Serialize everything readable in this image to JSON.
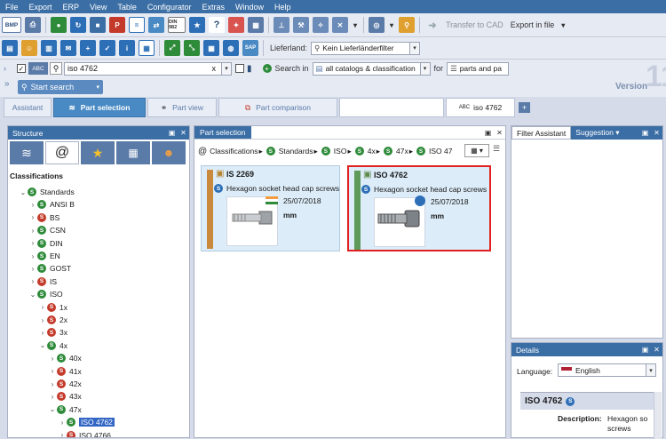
{
  "menu": [
    "File",
    "Export",
    "ERP",
    "View",
    "Table",
    "Configurator",
    "Extras",
    "Window",
    "Help"
  ],
  "toolbar1": {
    "bmp_label": "BMP",
    "din_label": "DIN 982",
    "transfer_cad": "Transfer to CAD",
    "export_file": "Export in file"
  },
  "toolbar2": {
    "lieferland_label": "Lieferland:",
    "lieferland_value": "Kein Lieferländerfilter"
  },
  "search": {
    "abc": "ABC",
    "query": "iso 4762",
    "clear": "x",
    "search_in_label": "Search in",
    "search_in_value": "all catalogs & classification",
    "for_label": "for",
    "for_value": "parts and pa",
    "start_button": "Start search",
    "version_label": "Version",
    "version_number": "11"
  },
  "tabs": {
    "assistant": "Assistant",
    "part_selection": "Part selection",
    "part_view": "Part view",
    "part_comparison": "Part comparison",
    "query_tab": "iso 4762",
    "abc": "ABC",
    "add": "+"
  },
  "structure": {
    "title": "Structure",
    "at_sign": "@",
    "classifications_label": "Classifications",
    "tree": [
      {
        "label": "Standards",
        "color": "green",
        "level": 0,
        "expanded": true
      },
      {
        "label": "ANSI B",
        "color": "green",
        "level": 1
      },
      {
        "label": "BS",
        "color": "red",
        "level": 1
      },
      {
        "label": "CSN",
        "color": "green",
        "level": 1
      },
      {
        "label": "DIN",
        "color": "green",
        "level": 1
      },
      {
        "label": "EN",
        "color": "green",
        "level": 1
      },
      {
        "label": "GOST",
        "color": "green",
        "level": 1
      },
      {
        "label": "IS",
        "color": "red",
        "level": 1
      },
      {
        "label": "ISO",
        "color": "green",
        "level": 1,
        "expanded": true
      },
      {
        "label": "1x",
        "color": "red",
        "level": 2
      },
      {
        "label": "2x",
        "color": "red",
        "level": 2
      },
      {
        "label": "3x",
        "color": "red",
        "level": 2
      },
      {
        "label": "4x",
        "color": "green",
        "level": 2,
        "expanded": true
      },
      {
        "label": "40x",
        "color": "green",
        "level": 3
      },
      {
        "label": "41x",
        "color": "red",
        "level": 3
      },
      {
        "label": "42x",
        "color": "red",
        "level": 3
      },
      {
        "label": "43x",
        "color": "red",
        "level": 3
      },
      {
        "label": "47x",
        "color": "green",
        "level": 3,
        "expanded": true
      },
      {
        "label": "ISO 4762",
        "color": "green",
        "level": 4,
        "selected": true
      },
      {
        "label": "ISO 4766",
        "color": "red",
        "level": 4
      }
    ]
  },
  "part_selection": {
    "title": "Part selection",
    "at_sign": "@",
    "breadcrumb": [
      "Classifications",
      "Standards",
      "ISO",
      "4x",
      "47x",
      "ISO 47"
    ],
    "cards": [
      {
        "id": "IS 2269",
        "desc": "Hexagon socket head cap screws",
        "date": "25/07/2018",
        "unit": "mm",
        "bar_color": "#c98a3e"
      },
      {
        "id": "ISO 4762",
        "desc": "Hexagon socket head cap screws",
        "date": "25/07/2018",
        "unit": "mm",
        "bar_color": "#5e9a5a"
      }
    ]
  },
  "filter": {
    "title": "Filter Assistant",
    "suggestion_tab": "Suggestion"
  },
  "details": {
    "title": "Details",
    "language_label": "Language:",
    "language_value": "English",
    "part_title": "ISO 4762",
    "description_label": "Description:",
    "description_value": "Hexagon so screws"
  }
}
